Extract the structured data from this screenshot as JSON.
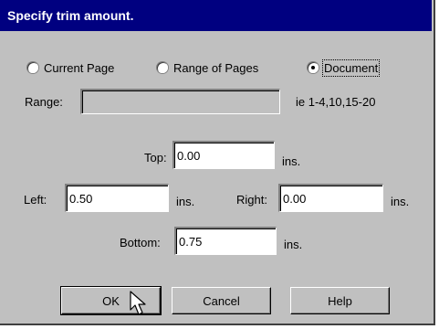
{
  "dialog": {
    "title": "Specify trim amount."
  },
  "scope": {
    "options": [
      {
        "label": "Current Page",
        "selected": false
      },
      {
        "label": "Range of Pages",
        "selected": false
      },
      {
        "label": "Document",
        "selected": true
      }
    ]
  },
  "range": {
    "label": "Range:",
    "value": "",
    "hint": "ie 1-4,10,15-20"
  },
  "margins": {
    "top": {
      "label": "Top:",
      "value": "0.00",
      "unit": "ins."
    },
    "left": {
      "label": "Left:",
      "value": "0.50",
      "unit": "ins."
    },
    "right": {
      "label": "Right:",
      "value": "0.00",
      "unit": "ins."
    },
    "bottom": {
      "label": "Bottom:",
      "value": "0.75",
      "unit": "ins."
    }
  },
  "buttons": {
    "ok": "OK",
    "cancel": "Cancel",
    "help": "Help"
  },
  "colors": {
    "titlebar": "#000080",
    "face": "#c0c0c0"
  }
}
